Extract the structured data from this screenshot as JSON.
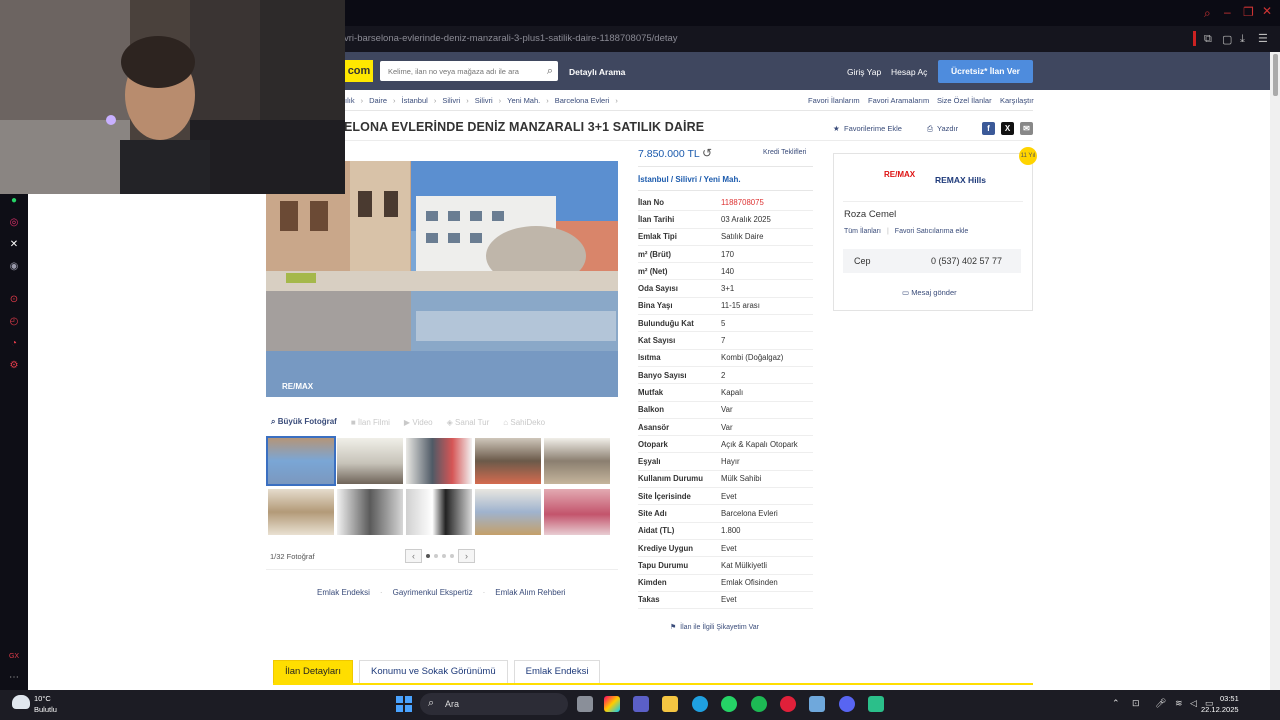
{
  "browser": {
    "url": "vri-barselona-evlerinde-deniz-manzarali-3-plus1-satilik-daire-1188708075/detay"
  },
  "header": {
    "logo": "com",
    "search_placeholder": "Kelime, ilan no veya mağaza adı ile ara",
    "detailed_search": "Detaylı Arama",
    "login": "Giriş Yap",
    "register": "Hesap Aç",
    "post_button": "Ücretsiz* İlan Ver"
  },
  "breadcrumb": [
    "ılık",
    "Daire",
    "İstanbul",
    "Silivri",
    "Silivri",
    "Yeni Mah.",
    "Barcelona Evleri"
  ],
  "breadcrumb_right": [
    "Favori İlanlarım",
    "Favori Aramalarım",
    "Size Özel İlanlar",
    "Karşılaştır"
  ],
  "listing": {
    "title": "ELONA EVLERİNDE DENİZ MANZARALI 3+1 SATILIK DAİRE",
    "add_favorite": "Favorilerime Ekle",
    "print": "Yazdır",
    "price": "7.850.000 TL",
    "credit_offers": "Kredi Teklifleri",
    "location": [
      "İstanbul",
      "Silivri",
      "Yeni Mah."
    ],
    "details": [
      {
        "key": "İlan No",
        "value": "1188708075",
        "highlight": true
      },
      {
        "key": "İlan Tarihi",
        "value": "03 Aralık 2025"
      },
      {
        "key": "Emlak Tipi",
        "value": "Satılık Daire"
      },
      {
        "key": "m² (Brüt)",
        "value": "170"
      },
      {
        "key": "m² (Net)",
        "value": "140"
      },
      {
        "key": "Oda Sayısı",
        "value": "3+1"
      },
      {
        "key": "Bina Yaşı",
        "value": "11-15 arası"
      },
      {
        "key": "Bulunduğu Kat",
        "value": "5"
      },
      {
        "key": "Kat Sayısı",
        "value": "7"
      },
      {
        "key": "Isıtma",
        "value": "Kombi (Doğalgaz)"
      },
      {
        "key": "Banyo Sayısı",
        "value": "2"
      },
      {
        "key": "Mutfak",
        "value": "Kapalı"
      },
      {
        "key": "Balkon",
        "value": "Var"
      },
      {
        "key": "Asansör",
        "value": "Var"
      },
      {
        "key": "Otopark",
        "value": "Açık & Kapalı Otopark"
      },
      {
        "key": "Eşyalı",
        "value": "Hayır"
      },
      {
        "key": "Kullanım Durumu",
        "value": "Mülk Sahibi"
      },
      {
        "key": "Site İçerisinde",
        "value": "Evet"
      },
      {
        "key": "Site Adı",
        "value": "Barcelona Evleri"
      },
      {
        "key": "Aidat (TL)",
        "value": "1.800"
      },
      {
        "key": "Krediye Uygun",
        "value": "Evet"
      },
      {
        "key": "Tapu Durumu",
        "value": "Kat Mülkiyetli"
      },
      {
        "key": "Kimden",
        "value": "Emlak Ofisinden"
      },
      {
        "key": "Takas",
        "value": "Evet"
      }
    ],
    "complaint": "İlan ile İlgili Şikayetim Var"
  },
  "gallery": {
    "tools": [
      "Büyük Fotoğraf",
      "İlan Filmi",
      "Video",
      "Sanal Tur",
      "SahiDeko"
    ],
    "count": "1/32 Fotoğraf",
    "photo_watermark": "RE/MAX Hills"
  },
  "bottom_links": [
    "Emlak Endeksi",
    "Gayrimenkul Ekspertiz",
    "Emlak Alım Rehberi"
  ],
  "agent": {
    "logo": "RE/MAX Hills",
    "office": "REMAX Hills",
    "name": "Roza Cemel",
    "all_listings": "Tüm İlanları",
    "favorite_sellers": "Favori Satıcılarıma ekle",
    "phone_label": "Cep",
    "phone": "0 (537) 402 57 77",
    "message": "Mesaj gönder",
    "badge": "11 Yıl"
  },
  "tabs": [
    "İlan Detayları",
    "Konumu ve Sokak Görünümü",
    "Emlak Endeksi"
  ],
  "taskbar": {
    "temp": "10°C",
    "weather": "Bulutlu",
    "search": "Ara",
    "time": "03:51",
    "date": "22.12.2025"
  },
  "colors": {
    "header_bg": "#3f475f",
    "accent_yellow": "#ffde00",
    "link_blue": "#1c5bad",
    "post_button": "#4e8cdd"
  }
}
